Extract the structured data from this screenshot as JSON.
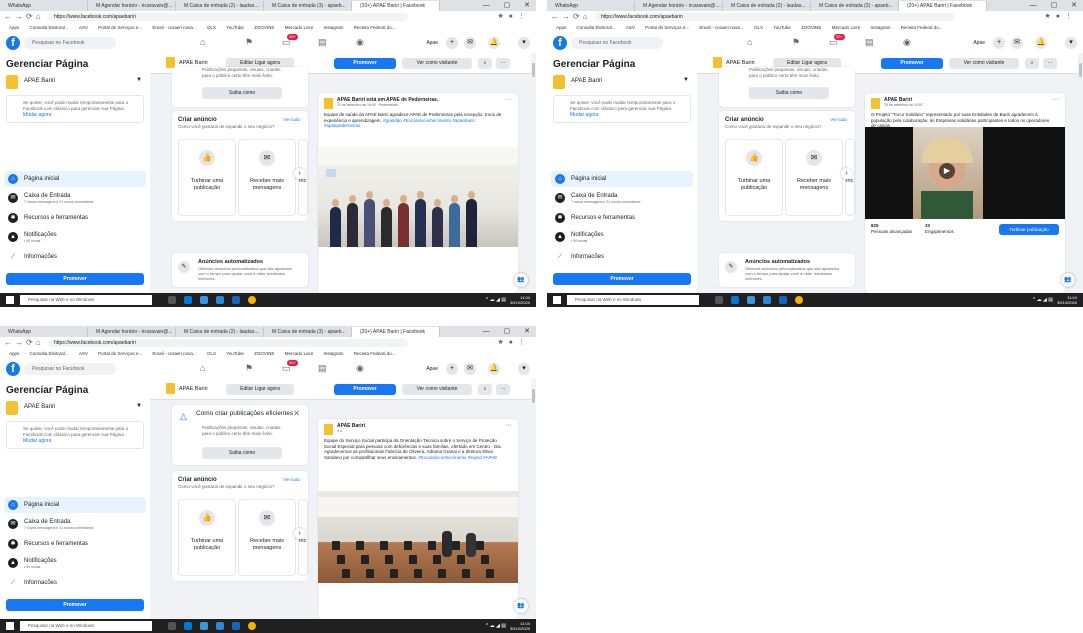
{
  "browser": {
    "tabs": [
      "WhatsApp",
      "M Agendar horário - ricaravain@...",
      "M Caixa de entrada (2) - laudas...",
      "M Caixa de entrada (3) - apaeb...",
      "(20+) APAE Bariri | Facebook"
    ],
    "url": "https://www.facebook.com/apaebariri",
    "bookmarks": [
      "Apps",
      "Consulta Eleitoral...",
      "ASV",
      "Portal de Serviços e...",
      "Email - ccsaeri.nosa...",
      "OLX",
      "YouTube",
      "ZOOVINE",
      "Mercado Livre",
      "Instagram",
      "Receita Federal do..."
    ],
    "window_controls": "—  ▢  ✕"
  },
  "fb": {
    "search_placeholder": "Pesquisar no Facebook",
    "nav_badge": "20+",
    "user_name": "Apae",
    "top_badge": "20+",
    "sidebar_title": "Gerenciar Página",
    "page_name": "APAE Bariri",
    "note_text": "Se quiser, você pode mudar temporariamente para o Facebook.com clássico para gerenciar sua Página.",
    "note_link": "Mudar agora",
    "nav": {
      "home": "Página inicial",
      "inbox": "Caixa de Entrada",
      "inbox_sub": "7 novas mensagens e 21 novos comentários",
      "resources": "Recursos e ferramentas",
      "notifications": "Notificações",
      "notifications_sub": "• 99 novas",
      "insights": "Informacões"
    },
    "promote_label": "Promover",
    "pagebar": {
      "name": "APAE Bariri",
      "call": "Editar Ligar agora",
      "promote": "Promover",
      "visitor": "Ver como visitante"
    },
    "tip": {
      "title": "Como criar publicações eficientes",
      "text": "Publicações pequenas, visuais, criadas para o público certo têm mais êxito.",
      "button": "Saiba como"
    },
    "ads": {
      "title": "Criar anúncio",
      "see_all": "Ver tudo",
      "subtitle": "Como você gostaria de expandir o seu negócio?",
      "tile1": "Turbinar uma publicação",
      "tile2": "Receber mais mensagens",
      "tile3": "Inc"
    },
    "auto": {
      "title": "Anúncios automatizados",
      "text": "Obtenha anúncios personalizados que são ajustados com o tempo para ajudar você a obter resultados melhores."
    }
  },
  "shots": [
    {
      "post_head": "APAE Bariri está em APAE de Pederneiras.",
      "post_meta": "24 de setembro às 16:00 · Pederneiras",
      "post_text": "Equipe de saúde da APAE Bariri agradece APAE de Pederneiras pela recepção, troca de experiência e aprendizagem.",
      "post_tags": "#gratidão #trocandoconhecimento #apaebariri #apaepederneiras"
    },
    {
      "post_head": "APAE Bariri",
      "post_meta": "25 de setembro às 10:57",
      "post_text": "O Projeto \"Troco Solidário\" representado por suas Entidades de Bariri agradecem à população pela colaboração, às Empresas solidárias participantes e todos os operadores de caixas.",
      "stats_left": "825",
      "stats_left_label": "Pessoas alcançadas",
      "stats_mid": "33",
      "stats_mid_label": "Engajamentos",
      "boost": "Turbinar publicação"
    },
    {
      "post_head": "APAE Bariri",
      "post_meta": "4 d",
      "post_text": "Equipe do Serviço Social participa da Orientação Técnica sobre o Serviço de Proteção Social Especial para pessoas com deficiências e suas famílias, ofertado em Centro - Dia.",
      "post_text2": "Agradecemos as profissionais Fabrícia de Oliveira, Adriana Granai e a diretora Silvia Sandano por compartilhar seus ensinamentos.",
      "post_tags": "#trocandoconhecimento #sspsd #APAE"
    }
  ],
  "taskbar": {
    "search": "Pesquisar na Web e no Windows",
    "time": "11:04",
    "date": "30/10/2020"
  }
}
